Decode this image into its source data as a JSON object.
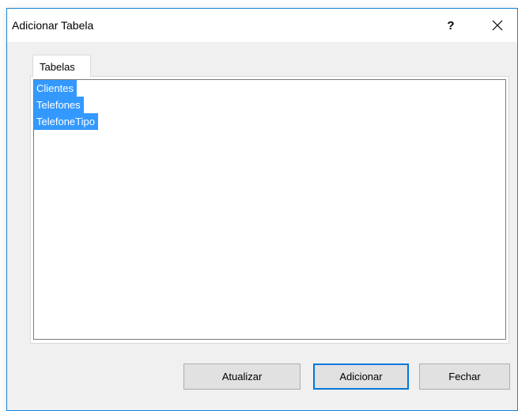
{
  "window": {
    "title": "Adicionar Tabela",
    "help_label": "?"
  },
  "tabs": [
    {
      "label": "Tabelas",
      "active": true
    }
  ],
  "tables": {
    "items": [
      "Clientes",
      "Telefones",
      "TelefoneTipo"
    ],
    "selected": [
      "Clientes",
      "Telefones",
      "TelefoneTipo"
    ]
  },
  "buttons": {
    "refresh": "Atualizar",
    "add": "Adicionar",
    "close": "Fechar"
  },
  "colors": {
    "accent": "#0078d7",
    "selection": "#3399ff",
    "window_border": "#1883d7",
    "dialog_bg": "#f0f0f0"
  }
}
